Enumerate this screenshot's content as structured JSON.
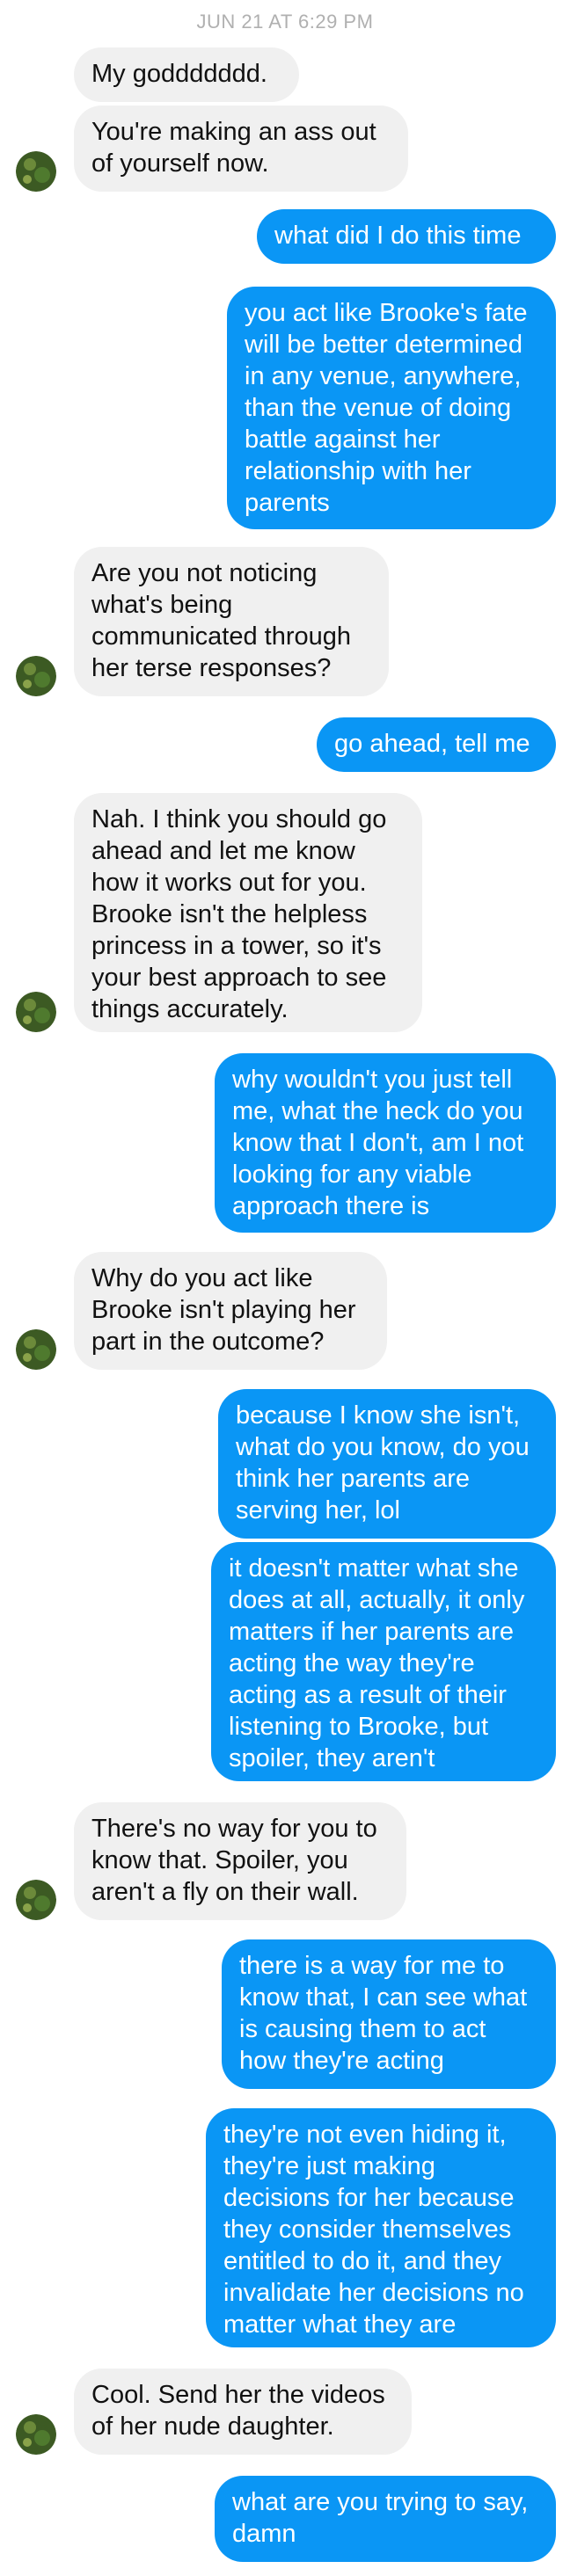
{
  "timestamp": "JUN 21 AT 6:29 PM",
  "colors": {
    "incoming_bubble": "#f0f0f0",
    "outgoing_bubble": "#0a96f5",
    "timestamp_text": "#b0b0b0"
  },
  "contact": {
    "avatar_icon": "contact-avatar"
  },
  "messages": [
    {
      "side": "in",
      "text": "My goddddddd."
    },
    {
      "side": "in",
      "text": "You're making an ass out\nof yourself now."
    },
    {
      "side": "out",
      "text": "what did I do this time"
    },
    {
      "side": "out",
      "text": "you act like Brooke's fate\nwill be better determined\nin any venue, anywhere,\nthan the venue of doing\nbattle against her\nrelationship with her\nparents"
    },
    {
      "side": "in",
      "text": "Are you not noticing\nwhat's being\ncommunicated through\nher terse responses?"
    },
    {
      "side": "out",
      "text": "go ahead, tell me"
    },
    {
      "side": "in",
      "text": "Nah. I think you should go\nahead and let me know\nhow it works out for you.\nBrooke isn't the helpless\nprincess in a tower, so it's\nyour best approach to see\nthings accurately."
    },
    {
      "side": "out",
      "text": "why wouldn't you just tell\nme, what the heck do you\nknow that I don't, am I not\nlooking for any viable\napproach there is"
    },
    {
      "side": "in",
      "text": "Why do you act like\nBrooke isn't playing her\npart in the outcome?"
    },
    {
      "side": "out",
      "text": "because I know she isn't,\nwhat do you know, do you\nthink her parents are\nserving her, lol"
    },
    {
      "side": "out",
      "text": "it doesn't matter what she\ndoes at all, actually, it only\nmatters if her parents are\nacting the way they're\nacting as a result of their\nlistening to Brooke, but\nspoiler, they aren't"
    },
    {
      "side": "in",
      "text": "There's no way for you to\nknow that. Spoiler, you\naren't a fly on their wall."
    },
    {
      "side": "out",
      "text": "there is a way for me to\nknow that, I can see what\nis causing them to act\nhow they're acting"
    },
    {
      "side": "out",
      "text": "they're not even hiding it,\nthey're just making\ndecisions for her because\nthey consider themselves\nentitled to do it, and they\ninvalidate her decisions no\nmatter what they are"
    },
    {
      "side": "in",
      "text": "Cool. Send her the videos\nof her nude daughter."
    },
    {
      "side": "out",
      "text": "what are you trying to say,\ndamn"
    }
  ]
}
